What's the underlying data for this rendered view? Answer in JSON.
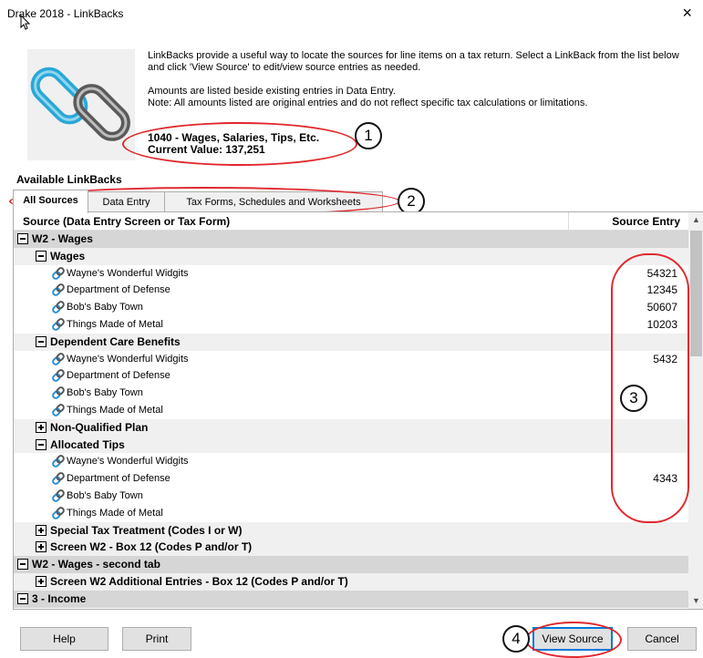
{
  "window": {
    "title": "Drake 2018 - LinkBacks",
    "close_label": "×"
  },
  "intro": {
    "paragraph1": "LinkBacks provide a useful way to locate the sources for line items on a tax return. Select a LinkBack from the list below and click 'View Source' to edit/view source entries as needed.",
    "paragraph2_line1": "Amounts are listed beside existing entries in Data Entry.",
    "paragraph2_line2": "Note: All amounts listed are original entries and do not reflect specific tax calculations or limitations."
  },
  "line_item": {
    "name": "1040 - Wages, Salaries, Tips, Etc.",
    "current_value": "Current Value: 137,251"
  },
  "section_label": "Available LinkBacks",
  "tabs": [
    {
      "label": "All Sources",
      "active": true
    },
    {
      "label": "Data Entry",
      "active": false
    },
    {
      "label": "Tax Forms, Schedules and Worksheets",
      "active": false
    }
  ],
  "table": {
    "col_source": "Source (Data Entry Screen or Tax Form)",
    "col_entry": "Source Entry",
    "rows": [
      {
        "type": "group",
        "label": "W2 - Wages",
        "expander": "minus",
        "value": ""
      },
      {
        "type": "sub",
        "label": "Wages",
        "expander": "minus",
        "value": ""
      },
      {
        "type": "item",
        "label": "Wayne's Wonderful Widgits",
        "value": "54321"
      },
      {
        "type": "item",
        "label": "Department of Defense",
        "value": "12345"
      },
      {
        "type": "item",
        "label": "Bob's Baby Town",
        "value": "50607"
      },
      {
        "type": "item",
        "label": "Things Made of Metal",
        "value": "10203"
      },
      {
        "type": "sub",
        "label": "Dependent Care Benefits",
        "expander": "minus",
        "value": ""
      },
      {
        "type": "item",
        "label": "Wayne's Wonderful Widgits",
        "value": "5432"
      },
      {
        "type": "item",
        "label": "Department of Defense",
        "value": ""
      },
      {
        "type": "item",
        "label": "Bob's Baby Town",
        "value": ""
      },
      {
        "type": "item",
        "label": "Things Made of Metal",
        "value": ""
      },
      {
        "type": "sub",
        "label": "Non-Qualified Plan",
        "expander": "plus",
        "value": ""
      },
      {
        "type": "sub",
        "label": "Allocated Tips",
        "expander": "minus",
        "value": ""
      },
      {
        "type": "item",
        "label": "Wayne's Wonderful Widgits",
        "value": ""
      },
      {
        "type": "item",
        "label": "Department of Defense",
        "value": "4343"
      },
      {
        "type": "item",
        "label": "Bob's Baby Town",
        "value": ""
      },
      {
        "type": "item",
        "label": "Things Made of Metal",
        "value": ""
      },
      {
        "type": "sub",
        "label": "Special Tax Treatment (Codes I or W)",
        "expander": "plus",
        "value": ""
      },
      {
        "type": "sub",
        "label": "Screen W2 - Box 12 (Codes P and/or T)",
        "expander": "plus",
        "value": ""
      },
      {
        "type": "group",
        "label": "W2 - Wages - second tab",
        "expander": "minus",
        "value": ""
      },
      {
        "type": "sub",
        "label": "Screen W2 Additional Entries - Box 12 (Codes P and/or T)",
        "expander": "plus",
        "value": ""
      },
      {
        "type": "group",
        "label": "3 - Income",
        "expander": "minus",
        "value": ""
      }
    ]
  },
  "buttons": {
    "help": "Help",
    "print": "Print",
    "view_source": "View Source",
    "cancel": "Cancel"
  },
  "annotations": [
    "1",
    "2",
    "3",
    "4"
  ],
  "colors": {
    "annotation_red": "#e0282e",
    "group_row": "#d6d6d6",
    "sub_row": "#f0f0f0",
    "link_icon_blue": "#2a8fd6"
  }
}
